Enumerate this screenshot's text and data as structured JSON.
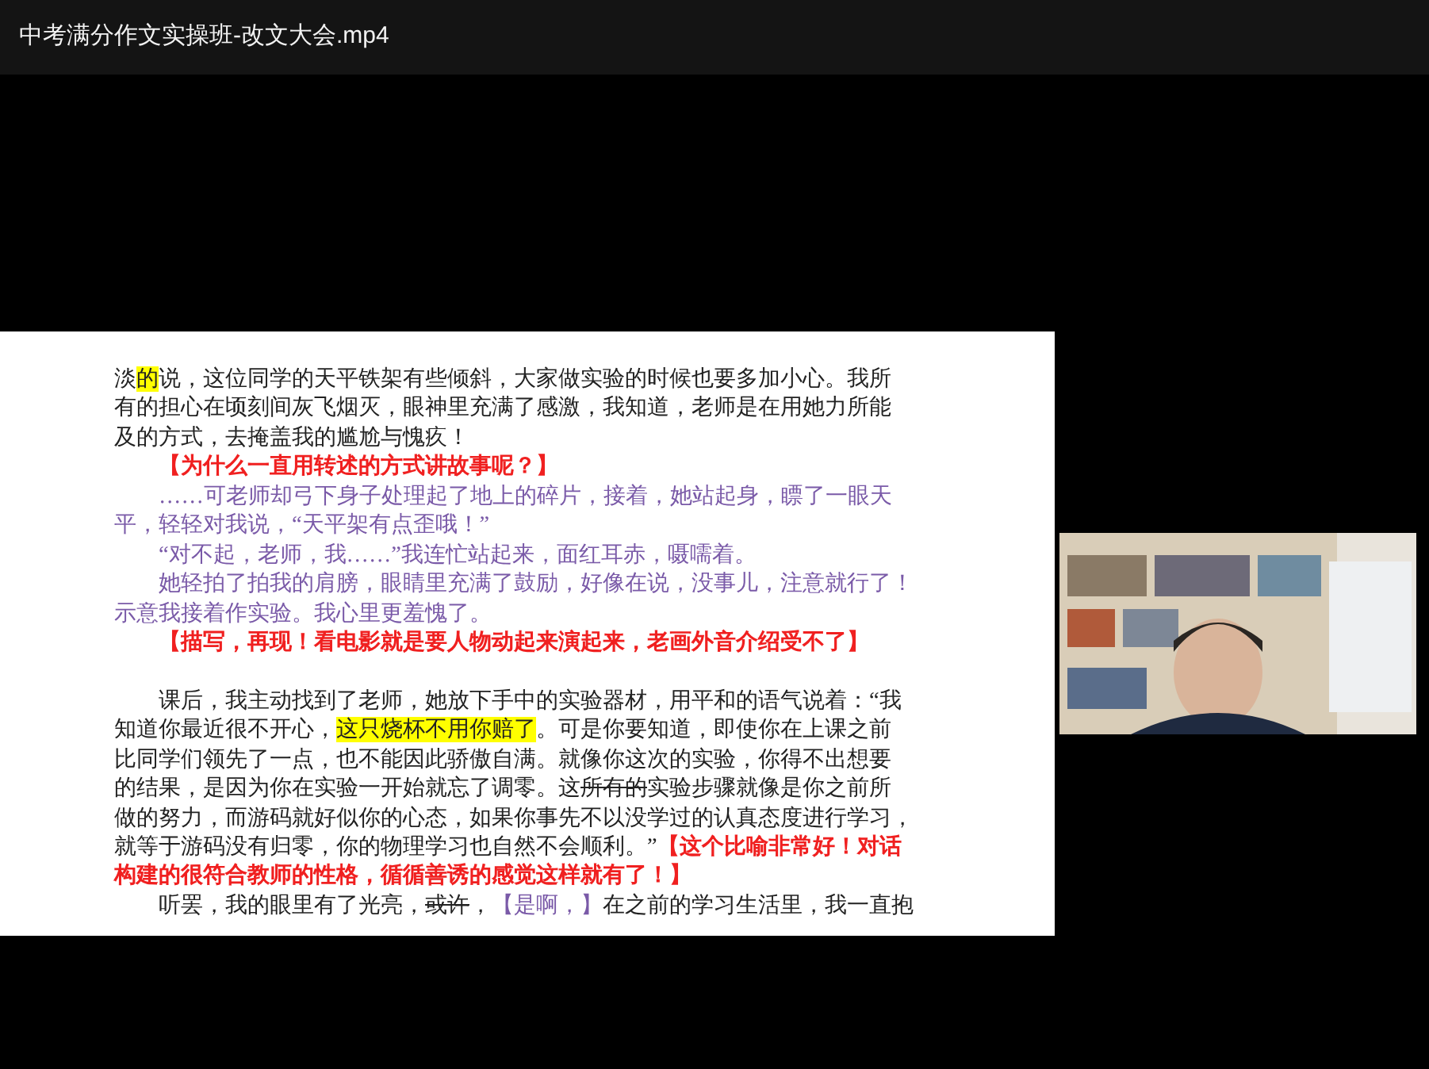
{
  "window": {
    "title": "中考满分作文实操班-改文大会.mp4"
  },
  "document": {
    "lines": [
      {
        "indent": false,
        "segments": [
          {
            "kind": "normal",
            "text": "淡"
          },
          {
            "kind": "highlight",
            "text": "的"
          },
          {
            "kind": "normal",
            "text": "说，这位同学的天平铁架有些倾斜，大家做实验的时候也要多加小心。我所"
          }
        ]
      },
      {
        "indent": false,
        "segments": [
          {
            "kind": "normal",
            "text": "有的担心在顷刻间灰飞烟灭，眼神里充满了感激，我知道，老师是在用她力所能"
          }
        ]
      },
      {
        "indent": false,
        "segments": [
          {
            "kind": "normal",
            "text": "及的方式，去掩盖我的尴尬与愧疚！"
          }
        ]
      },
      {
        "indent": true,
        "segments": [
          {
            "kind": "comment",
            "text": "【为什么一直用转述的方式讲故事呢？】"
          }
        ]
      },
      {
        "indent": true,
        "segments": [
          {
            "kind": "purple",
            "text": "……可老师却弓下身子处理起了地上的碎片，接着，她站起身，瞟了一眼天"
          }
        ]
      },
      {
        "indent": false,
        "segments": [
          {
            "kind": "purple",
            "text": "平，轻轻对我说，“天平架有点歪哦！”"
          }
        ]
      },
      {
        "indent": true,
        "segments": [
          {
            "kind": "purple",
            "text": "“对不起，老师，我……”我连忙站起来，面红耳赤，嗫嚅着。"
          }
        ]
      },
      {
        "indent": true,
        "segments": [
          {
            "kind": "purple",
            "text": "她轻拍了拍我的肩膀，眼睛里充满了鼓励，好像在说，没事儿，注意就行了！"
          }
        ]
      },
      {
        "indent": false,
        "segments": [
          {
            "kind": "purple",
            "text": "示意我接着作实验。我心里更羞愧了。"
          }
        ]
      },
      {
        "indent": true,
        "segments": [
          {
            "kind": "comment",
            "text": "【描写，再现！看电影就是要人物动起来演起来，老画外音介绍受不了】"
          }
        ]
      },
      {
        "kind": "blank"
      },
      {
        "indent": true,
        "segments": [
          {
            "kind": "normal",
            "text": "课后，我主动找到了老师，她放下手中的实验器材，用平和的语气说着：“我"
          }
        ]
      },
      {
        "indent": false,
        "segments": [
          {
            "kind": "normal",
            "text": "知道你最近很不开心，"
          },
          {
            "kind": "highlight",
            "text": "这只烧杯不用你赔了"
          },
          {
            "kind": "normal",
            "text": "。可是你要知道，即使你在上课之前"
          }
        ]
      },
      {
        "indent": false,
        "segments": [
          {
            "kind": "normal",
            "text": "比同学们领先了一点，也不能因此骄傲自满。就像你这次的实验，你得不出想要"
          }
        ]
      },
      {
        "indent": false,
        "segments": [
          {
            "kind": "normal",
            "text": "的结果，是因为你在实验一开始就忘了调零。这"
          },
          {
            "kind": "struck",
            "text": "所有的"
          },
          {
            "kind": "normal",
            "text": "实验步骤就像是你之前所"
          }
        ]
      },
      {
        "indent": false,
        "segments": [
          {
            "kind": "normal",
            "text": "做的努力，而游码就好似你的心态，如果你事先不以没学过的认真态度进行学习，"
          }
        ]
      },
      {
        "indent": false,
        "segments": [
          {
            "kind": "normal",
            "text": "就等于游码没有归零，你的物理学习也自然不会顺利。”"
          },
          {
            "kind": "comment",
            "text": "【这个比喻非常好！对话"
          }
        ]
      },
      {
        "indent": false,
        "segments": [
          {
            "kind": "comment",
            "text": "构建的很符合教师的性格，循循善诱的感觉这样就有了！】"
          }
        ]
      },
      {
        "indent": true,
        "segments": [
          {
            "kind": "normal",
            "text": "听罢，我的眼里有了光亮，"
          },
          {
            "kind": "struck",
            "text": "或许"
          },
          {
            "kind": "normal",
            "text": "，"
          },
          {
            "kind": "purple",
            "text": "【是啊，】"
          },
          {
            "kind": "normal",
            "text": "在之前的学习生活里，我一直抱"
          }
        ]
      }
    ]
  }
}
